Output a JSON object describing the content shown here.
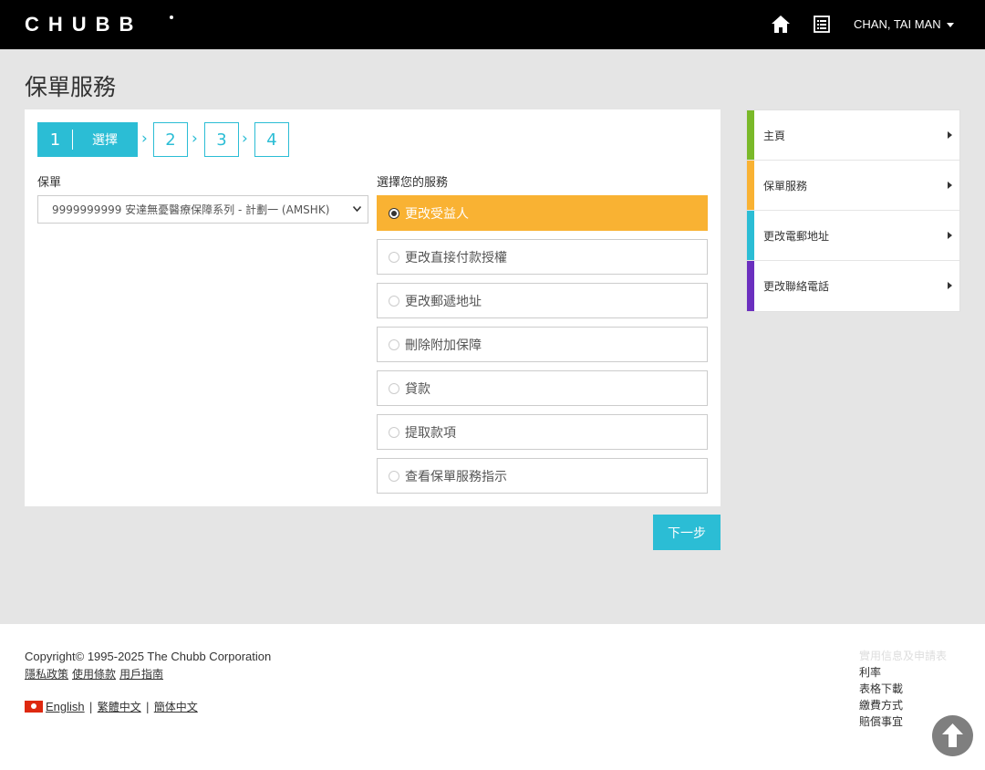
{
  "header": {
    "logo_text": "CHUBB",
    "home_icon": "home-icon",
    "doc_icon": "document-list-icon",
    "user_name": "CHAN, TAI MAN"
  },
  "page": {
    "title": "保單服務"
  },
  "steps": [
    {
      "number": "1",
      "label": "選擇"
    },
    {
      "number": "2"
    },
    {
      "number": "3"
    },
    {
      "number": "4"
    }
  ],
  "policy": {
    "label": "保單",
    "selected_value": "9999999999 安達無憂醫療保障系列 - 計劃一 (AMSHK)"
  },
  "services": {
    "label": "選擇您的服務",
    "options": [
      {
        "label": "更改受益人",
        "selected": true
      },
      {
        "label": "更改直接付款授權",
        "selected": false
      },
      {
        "label": "更改郵遞地址",
        "selected": false
      },
      {
        "label": "刪除附加保障",
        "selected": false
      },
      {
        "label": "貸款",
        "selected": false
      },
      {
        "label": "提取款項",
        "selected": false
      },
      {
        "label": "查看保單服務指示",
        "selected": false
      }
    ]
  },
  "next_button": "下一步",
  "sidebar": {
    "items": [
      {
        "label": "主頁",
        "color": "#7ab929"
      },
      {
        "label": "保單服務",
        "color": "#f9b233"
      },
      {
        "label": "更改電郵地址",
        "color": "#2bbdd5"
      },
      {
        "label": "更改聯絡電話",
        "color": "#6b2fbf"
      }
    ]
  },
  "footer": {
    "copyright": "Copyright© 1995-2025 The Chubb Corporation",
    "legal_links": [
      "隱私政策",
      "使用條款",
      "用戶指南"
    ],
    "languages": [
      "English",
      "繁體中文",
      "簡体中文"
    ],
    "quick_links_title": "實用信息及申請表",
    "quick_links": [
      "利率",
      "表格下載",
      "繳費方式",
      "賠償事宜"
    ]
  },
  "colors": {
    "accent": "#2bbdd5",
    "selected_option": "#f9b233",
    "header_bg": "#000000"
  }
}
